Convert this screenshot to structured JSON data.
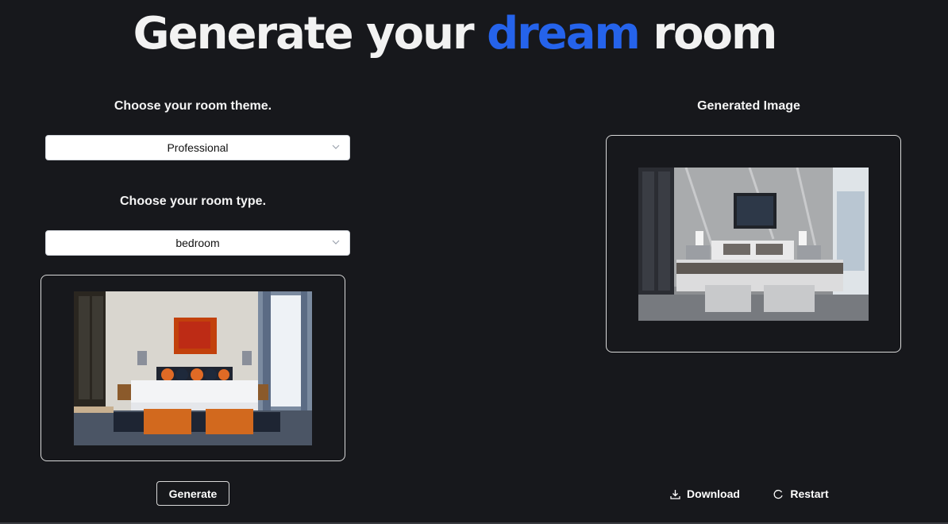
{
  "header": {
    "title_part1": "Generate your ",
    "title_accent": "dream",
    "title_part2": " room",
    "accent_color": "#2563eb"
  },
  "left_panel": {
    "theme_label": "Choose your room theme.",
    "theme_value": "Professional",
    "type_label": "Choose your room type.",
    "type_value": "bedroom",
    "input_image": "bedroom-photo",
    "generate_label": "Generate"
  },
  "right_panel": {
    "output_label": "Generated Image",
    "output_image": "generated-bedroom-photo",
    "download_label": "Download",
    "restart_label": "Restart"
  }
}
